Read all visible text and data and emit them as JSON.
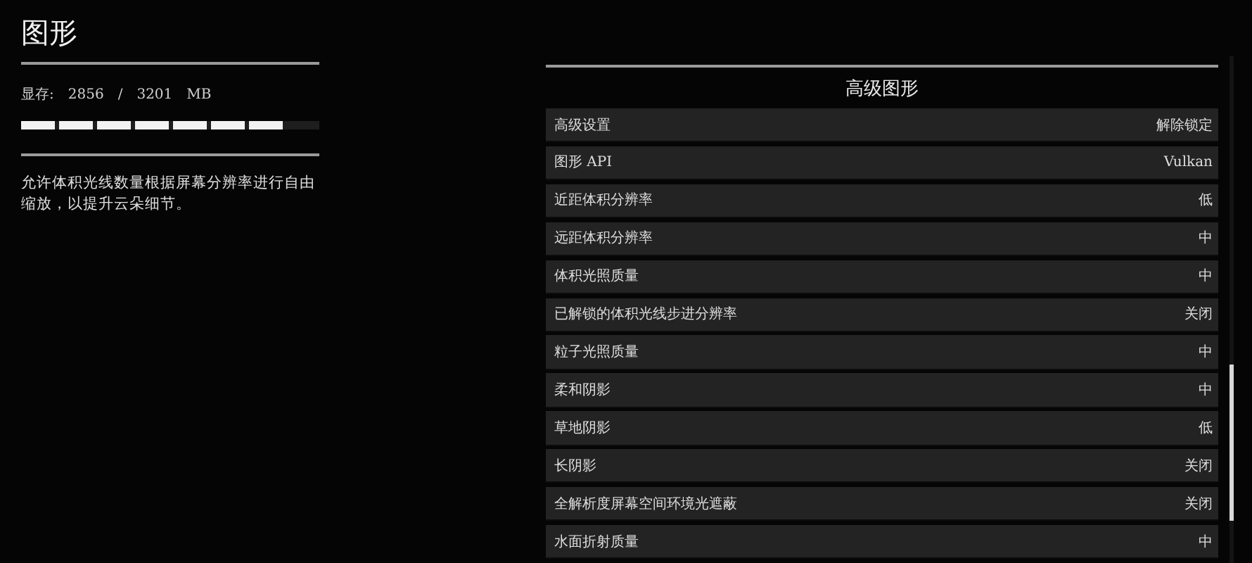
{
  "page_title": "图形",
  "vram": {
    "label": "显存:",
    "used": "2856",
    "separator": "/",
    "total": "3201",
    "unit": "MB",
    "level": 0.89
  },
  "description": "允许体积光线数量根据屏幕分辨率进行自由缩放，以提升云朵细节。",
  "panel": {
    "title": "高级图形",
    "rows": [
      {
        "label": "高级设置",
        "value": "解除锁定"
      },
      {
        "label": "图形 API",
        "value": "Vulkan"
      },
      {
        "label": "近距体积分辨率",
        "value": "低"
      },
      {
        "label": "远距体积分辨率",
        "value": "中"
      },
      {
        "label": "体积光照质量",
        "value": "中"
      },
      {
        "label": "已解锁的体积光线步进分辨率",
        "value": "关闭"
      },
      {
        "label": "粒子光照质量",
        "value": "中"
      },
      {
        "label": "柔和阴影",
        "value": "中"
      },
      {
        "label": "草地阴影",
        "value": "低"
      },
      {
        "label": "长阴影",
        "value": "关闭"
      },
      {
        "label": "全解析度屏幕空间环境光遮蔽",
        "value": "关闭"
      },
      {
        "label": "水面折射质量",
        "value": "中"
      }
    ]
  }
}
